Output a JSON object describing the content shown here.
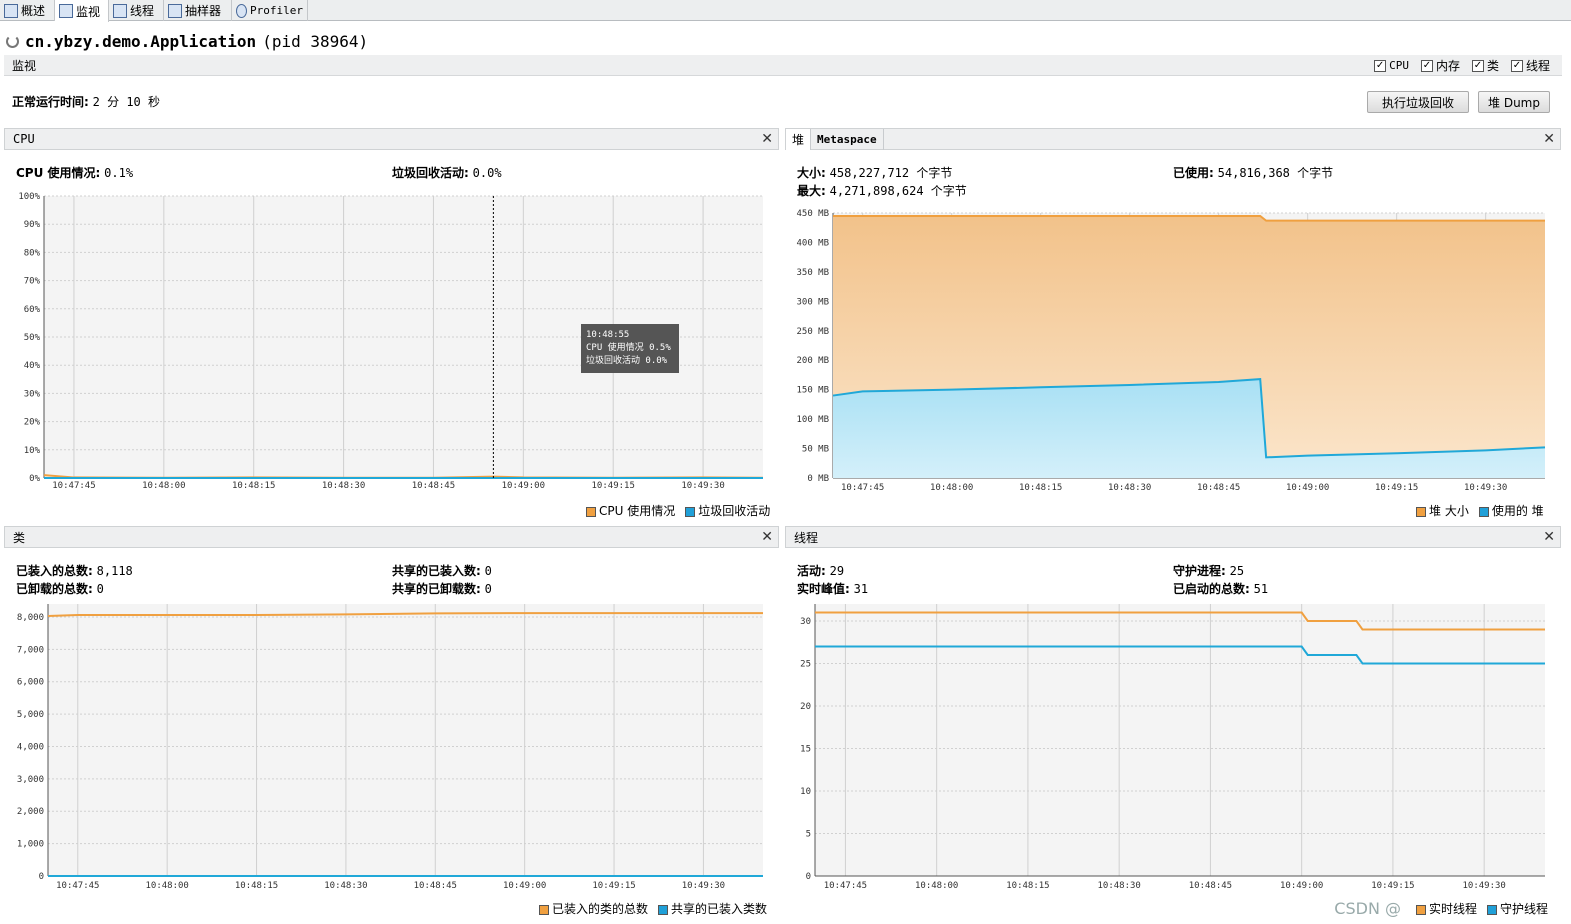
{
  "tabs": [
    {
      "label": "概述"
    },
    {
      "label": "监视"
    },
    {
      "label": "线程"
    },
    {
      "label": "抽样器"
    },
    {
      "label": "Profiler"
    }
  ],
  "app": {
    "name": "cn.ybzy.demo.Application",
    "pid": "(pid 38964)"
  },
  "monitor": {
    "title": "监视",
    "checks": [
      "CPU",
      "内存",
      "类",
      "线程"
    ]
  },
  "uptime": {
    "label": "正常运行时间:",
    "value": "2 分 10 秒"
  },
  "buttons": {
    "gc": "执行垃圾回收",
    "heapdump": "堆 Dump"
  },
  "x_ticks": [
    "10:47:45",
    "10:48:00",
    "10:48:15",
    "10:48:30",
    "10:48:45",
    "10:49:00",
    "10:49:15",
    "10:49:30"
  ],
  "cpu": {
    "title": "CPU",
    "usage_label": "CPU 使用情况:",
    "usage_value": "0.1%",
    "gc_label": "垃圾回收活动:",
    "gc_value": "0.0%",
    "legend": [
      "CPU 使用情况",
      "垃圾回收活动"
    ],
    "tooltip": {
      "time": "10:48:55",
      "line1": "CPU 使用情况  0.5%",
      "line2": "垃圾回收活动  0.0%"
    }
  },
  "heap": {
    "tab_heap": "堆",
    "tab_meta": "Metaspace",
    "size_label": "大小:",
    "size_value": "458,227,712 个字节",
    "max_label": "最大:",
    "max_value": "4,271,898,624 个字节",
    "used_label": "已使用:",
    "used_value": "54,816,368 个字节",
    "legend": [
      "堆 大小",
      "使用的 堆"
    ]
  },
  "classes": {
    "title": "类",
    "loaded_label": "已装入的总数:",
    "loaded_value": "8,118",
    "unloaded_label": "已卸载的总数:",
    "unloaded_value": "0",
    "shared_loaded_label": "共享的已装入数:",
    "shared_loaded_value": "0",
    "shared_unloaded_label": "共享的已卸载数:",
    "shared_unloaded_value": "0",
    "legend": [
      "已装入的类的总数",
      "共享的已装入类数"
    ]
  },
  "threads": {
    "title": "线程",
    "live_label": "活动:",
    "live_value": "29",
    "peak_label": "实时峰值:",
    "peak_value": "31",
    "daemon_label": "守护进程:",
    "daemon_value": "25",
    "started_label": "已启动的总数:",
    "started_value": "51",
    "legend": [
      "实时线程",
      "守护线程"
    ]
  },
  "watermark": "CSDN @",
  "chart_data": [
    {
      "type": "line",
      "name": "cpu",
      "x": [
        "10:47:40",
        "10:47:45",
        "10:48:00",
        "10:48:15",
        "10:48:30",
        "10:48:45",
        "10:48:55",
        "10:49:00",
        "10:49:15",
        "10:49:30",
        "10:49:40"
      ],
      "series": [
        {
          "name": "CPU 使用情况",
          "values": [
            1.0,
            0.2,
            0.1,
            0.2,
            0.1,
            0.1,
            0.5,
            0.2,
            0.1,
            0.2,
            0.1
          ]
        },
        {
          "name": "垃圾回收活动",
          "values": [
            0,
            0,
            0,
            0,
            0,
            0,
            0,
            0,
            0,
            0,
            0
          ]
        }
      ],
      "yticks": [
        "0%",
        "10%",
        "20%",
        "30%",
        "40%",
        "50%",
        "60%",
        "70%",
        "80%",
        "90%",
        "100%"
      ],
      "ylim": [
        0,
        100
      ]
    },
    {
      "type": "area",
      "name": "heap",
      "x": [
        "10:47:40",
        "10:47:45",
        "10:48:00",
        "10:48:15",
        "10:48:30",
        "10:48:45",
        "10:48:52",
        "10:48:53",
        "10:49:00",
        "10:49:15",
        "10:49:30",
        "10:49:40"
      ],
      "series": [
        {
          "name": "堆 大小",
          "values": [
            445,
            445,
            445,
            445,
            445,
            445,
            445,
            437,
            437,
            437,
            437,
            437
          ]
        },
        {
          "name": "使用的 堆",
          "values": [
            140,
            147,
            150,
            154,
            158,
            163,
            168,
            35,
            38,
            42,
            47,
            52
          ]
        }
      ],
      "yticks": [
        "0 MB",
        "50 MB",
        "100 MB",
        "150 MB",
        "200 MB",
        "250 MB",
        "300 MB",
        "350 MB",
        "400 MB",
        "450 MB"
      ],
      "ylim": [
        0,
        450
      ]
    },
    {
      "type": "line",
      "name": "classes",
      "x": [
        "10:47:40",
        "10:47:45",
        "10:48:00",
        "10:48:15",
        "10:48:30",
        "10:48:45",
        "10:49:00",
        "10:49:15",
        "10:49:30",
        "10:49:40"
      ],
      "series": [
        {
          "name": "已装入的类的总数",
          "values": [
            8030,
            8060,
            8060,
            8060,
            8080,
            8110,
            8118,
            8118,
            8118,
            8118
          ]
        },
        {
          "name": "共享的已装入类数",
          "values": [
            0,
            0,
            0,
            0,
            0,
            0,
            0,
            0,
            0,
            0
          ]
        }
      ],
      "yticks": [
        "0",
        "1,000",
        "2,000",
        "3,000",
        "4,000",
        "5,000",
        "6,000",
        "7,000",
        "8,000"
      ],
      "ylim": [
        0,
        8400
      ]
    },
    {
      "type": "line",
      "name": "threads",
      "x": [
        "10:47:40",
        "10:47:45",
        "10:48:00",
        "10:48:15",
        "10:48:30",
        "10:48:45",
        "10:49:00",
        "10:49:01",
        "10:49:09",
        "10:49:10",
        "10:49:30",
        "10:49:40"
      ],
      "series": [
        {
          "name": "实时线程",
          "values": [
            31,
            31,
            31,
            31,
            31,
            31,
            31,
            30,
            30,
            29,
            29,
            29
          ]
        },
        {
          "name": "守护线程",
          "values": [
            27,
            27,
            27,
            27,
            27,
            27,
            27,
            26,
            26,
            25,
            25,
            25
          ]
        }
      ],
      "yticks": [
        "0",
        "5",
        "10",
        "15",
        "20",
        "25",
        "30"
      ],
      "ylim": [
        0,
        32
      ]
    }
  ]
}
